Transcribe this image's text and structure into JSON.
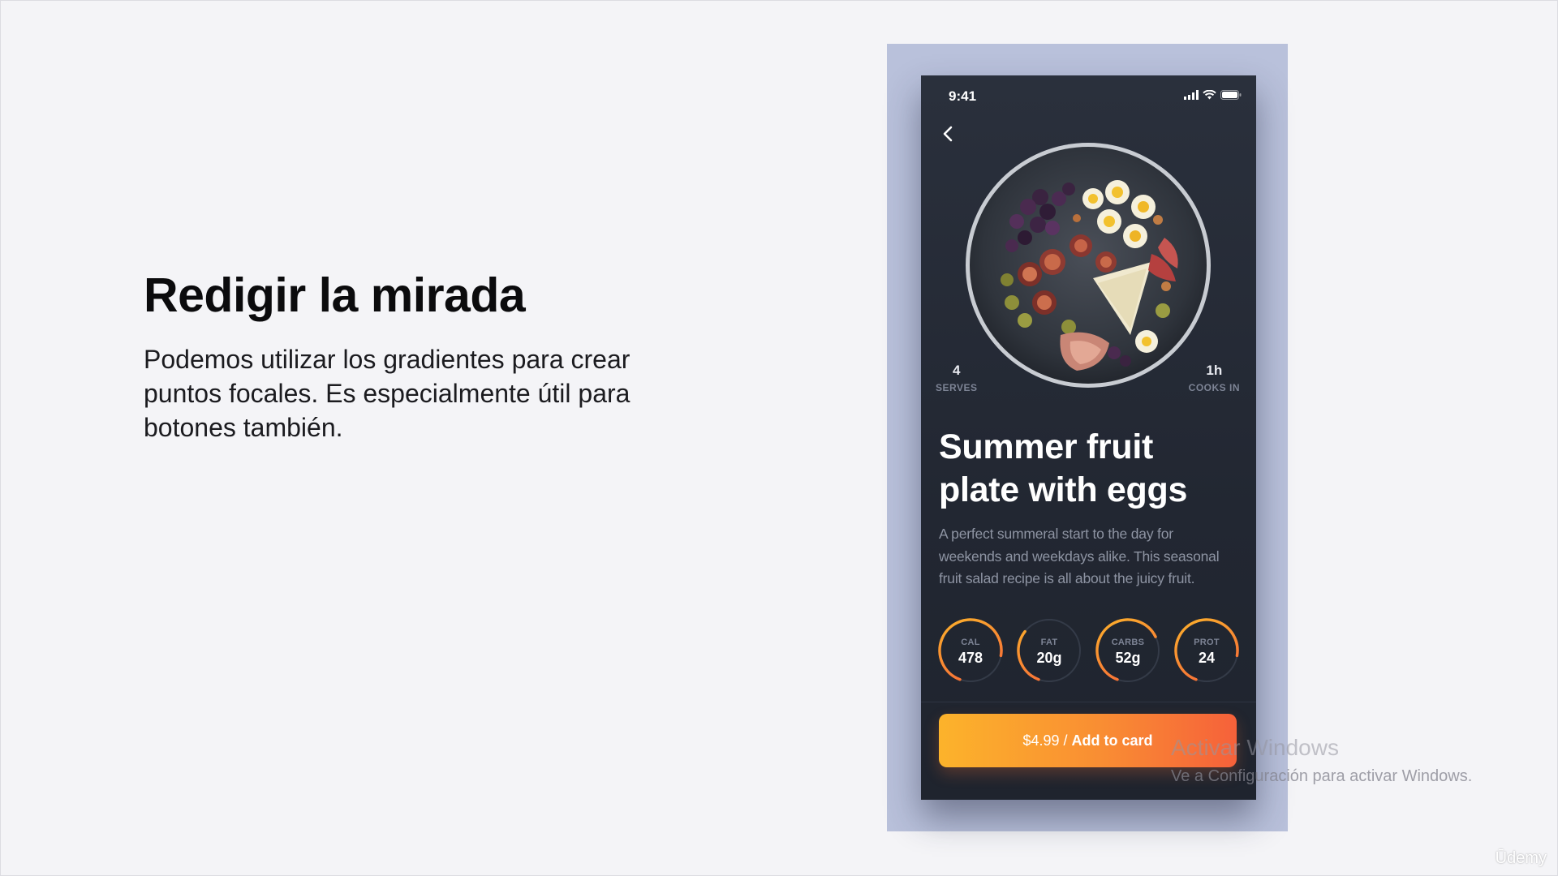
{
  "slide": {
    "title": "Redigir la mirada",
    "body": "Podemos utilizar los gradientes para crear puntos focales. Es especialmente útil para botones también."
  },
  "phone": {
    "status": {
      "time": "9:41",
      "icons": [
        "signal-icon",
        "wifi-icon",
        "battery-icon"
      ]
    },
    "back_icon": "chevron-left-icon",
    "stats": [
      {
        "value": "4",
        "label": "SERVES"
      },
      {
        "value": "1h",
        "label": "COOKS IN"
      }
    ],
    "recipe": {
      "title_line1": "Summer fruit",
      "title_line2": "plate with eggs",
      "desc_line1": "A perfect summeral start to the day for",
      "desc_line2": "weekends and weekdays alike. This seasonal",
      "desc_line3": "fruit salad recipe is all about the juicy fruit."
    },
    "nutrition": [
      {
        "label": "CAL",
        "value": "478",
        "fill": 0.72
      },
      {
        "label": "FAT",
        "value": "20g",
        "fill": 0.3
      },
      {
        "label": "CARBS",
        "value": "52g",
        "fill": 0.62
      },
      {
        "label": "PROT",
        "value": "24",
        "fill": 0.72
      }
    ],
    "cta": {
      "price": "$4.99 /",
      "action": "Add to card"
    },
    "colors": {
      "gradient_start": "#fcb32b",
      "gradient_mid": "#f98d33",
      "gradient_end": "#f6613a",
      "phone_bg": "#252a35",
      "frame_bg": "#b9c1db"
    }
  },
  "overlay": {
    "watermark_title": "Activar Windows",
    "watermark_sub": "Ve a Configuración para activar Windows.",
    "brand": "Ūdemy"
  }
}
